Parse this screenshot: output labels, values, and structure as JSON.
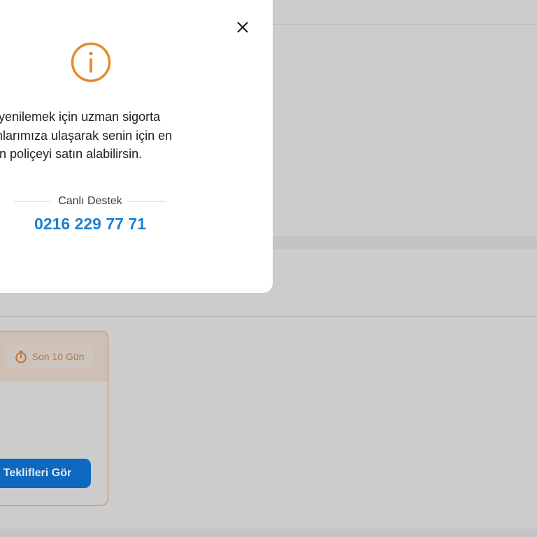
{
  "modal": {
    "message_lines": [
      "çeni yenilemek için uzman sigorta",
      "smanlarımıza ulaşarak senin için en",
      "uygun poliçeyi satın alabilirsin."
    ],
    "support_label": "Canlı Destek",
    "phone": "0216 229 77 71",
    "close_icon": "close-icon",
    "info_icon": "info-icon",
    "accent_color": "#e8892f",
    "phone_color": "#1f7fd1"
  },
  "policy_card": {
    "badge_label": "Son 10 Gün",
    "badge_icon": "stopwatch-icon",
    "cta_label": "Teklifleri Gör",
    "border_color": "#c78a4a",
    "cta_color": "#0d69bf"
  },
  "overlay": {
    "backdrop_color": "#cccccc"
  }
}
